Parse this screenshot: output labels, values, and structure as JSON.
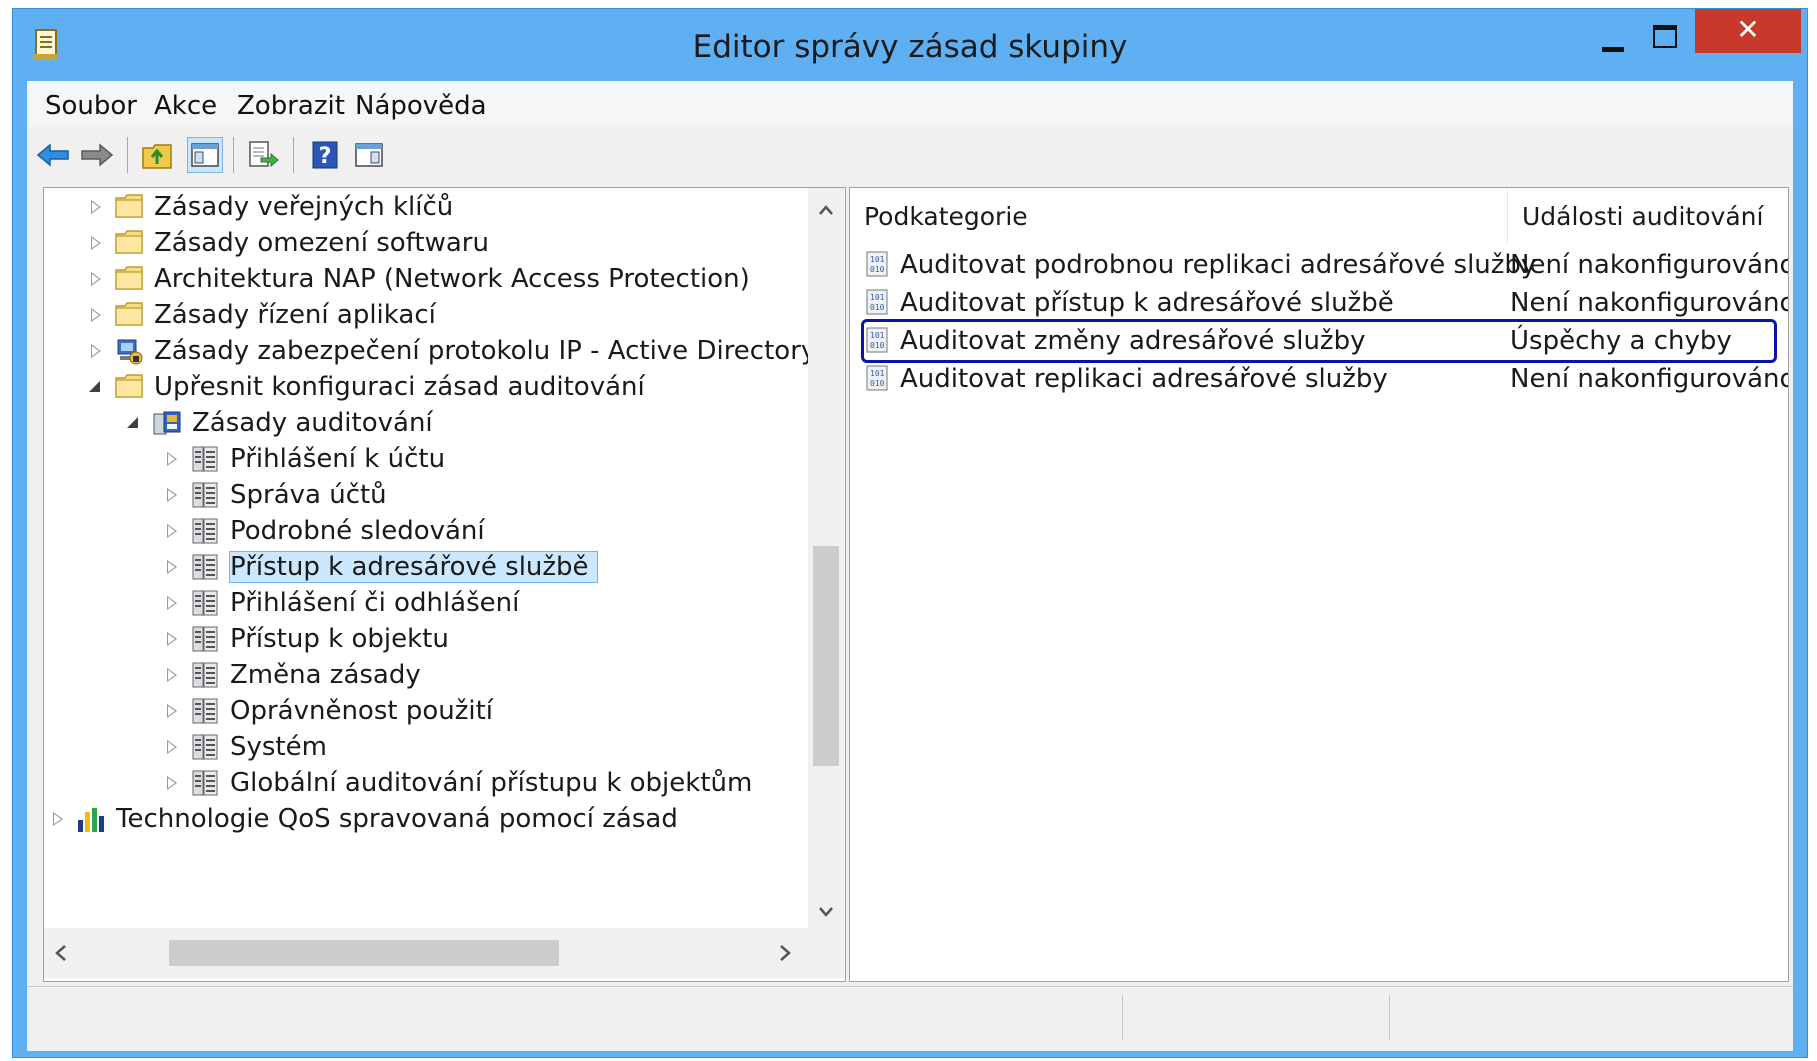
{
  "window": {
    "title": "Editor správy zásad skupiny",
    "close_glyph": "✕"
  },
  "menu": [
    "Soubor",
    "Akce",
    "Zobrazit",
    "Nápověda"
  ],
  "toolbar": {
    "icons": [
      "back-arrow-icon",
      "forward-arrow-icon",
      "up-folder-icon",
      "show-hide-tree-icon",
      "export-list-icon",
      "help-icon",
      "show-hide-action-pane-icon"
    ]
  },
  "tree": {
    "items": [
      {
        "label": "Zásady veřejných klíčů",
        "icon": "folder-icon",
        "expanded": false
      },
      {
        "label": "Zásady omezení softwaru",
        "icon": "folder-icon",
        "expanded": false
      },
      {
        "label": "Architektura NAP (Network Access Protection)",
        "icon": "folder-icon",
        "expanded": false
      },
      {
        "label": "Zásady řízení aplikací",
        "icon": "folder-icon",
        "expanded": false
      },
      {
        "label": "Zásady zabezpečení protokolu IP - Active Directory",
        "icon": "ipsec-policy-icon",
        "expanded": false
      },
      {
        "label": "Upřesnit konfiguraci zásad auditování",
        "icon": "folder-icon",
        "expanded": true
      },
      {
        "label": "Zásady auditování",
        "icon": "audit-policy-icon",
        "expanded": true
      },
      {
        "label": "Přihlášení k účtu",
        "icon": "audit-category-icon",
        "expanded": false
      },
      {
        "label": "Správa účtů",
        "icon": "audit-category-icon",
        "expanded": false
      },
      {
        "label": "Podrobné sledování",
        "icon": "audit-category-icon",
        "expanded": false
      },
      {
        "label": "Přístup k adresářové službě",
        "icon": "audit-category-icon",
        "expanded": false,
        "selected": true
      },
      {
        "label": "Přihlášení či odhlášení",
        "icon": "audit-category-icon",
        "expanded": false
      },
      {
        "label": "Přístup k objektu",
        "icon": "audit-category-icon",
        "expanded": false
      },
      {
        "label": "Změna zásady",
        "icon": "audit-category-icon",
        "expanded": false
      },
      {
        "label": "Oprávněnost použití",
        "icon": "audit-category-icon",
        "expanded": false
      },
      {
        "label": "Systém",
        "icon": "audit-category-icon",
        "expanded": false
      },
      {
        "label": "Globální auditování přístupu k objektům",
        "icon": "audit-category-icon",
        "expanded": false
      },
      {
        "label": "Technologie QoS spravovaná pomocí zásad",
        "icon": "qos-chart-icon",
        "expanded": false
      }
    ]
  },
  "list": {
    "columns": [
      "Podkategorie",
      "Události auditování"
    ],
    "rows": [
      {
        "name": "Auditovat podrobnou replikaci adresářové služby",
        "value": "Není nakonfigurováno"
      },
      {
        "name": "Auditovat přístup k adresářové službě",
        "value": "Není nakonfigurováno"
      },
      {
        "name": "Auditovat změny adresářové služby",
        "value": "Úspěchy a chyby",
        "focused": true
      },
      {
        "name": "Auditovat replikaci adresářové služby",
        "value": "Není nakonfigurováno"
      }
    ]
  }
}
